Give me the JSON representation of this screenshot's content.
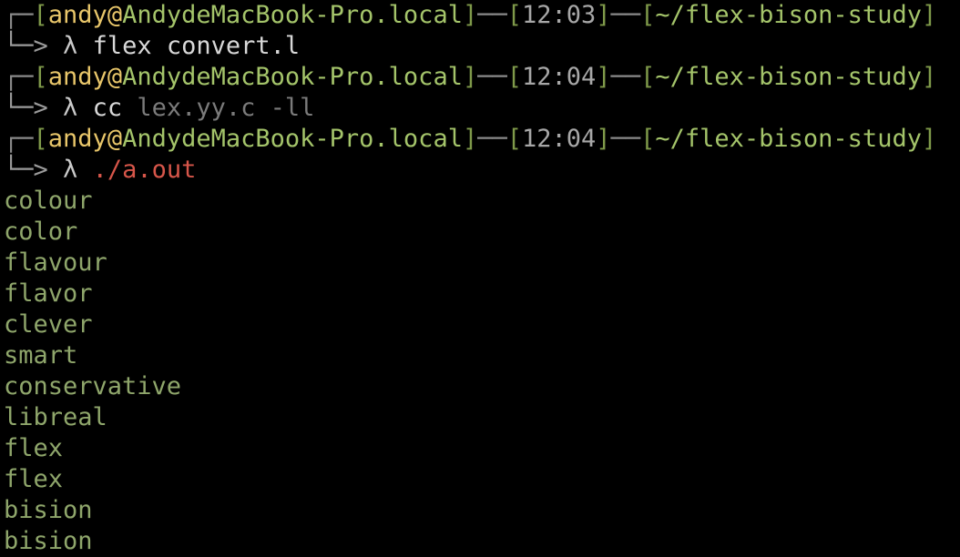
{
  "prompts": [
    {
      "prefix": "┌─",
      "user": "andy",
      "at": "@",
      "host": "AndydeMacBook-Pro.local",
      "sep": "─",
      "time": "12:03",
      "path": "~/flex-bison-study",
      "cmd_arrow": "└─>",
      "lambda": "λ",
      "command": "flex",
      "args": "convert.l"
    },
    {
      "prefix": "┌─",
      "user": "andy",
      "at": "@",
      "host": "AndydeMacBook-Pro.local",
      "sep": "─",
      "time": "12:04",
      "path": "~/flex-bison-study",
      "cmd_arrow": "└─>",
      "lambda": "λ",
      "command": "cc",
      "args": "lex.yy.c -ll"
    },
    {
      "prefix": "┌─",
      "user": "andy",
      "at": "@",
      "host": "AndydeMacBook-Pro.local",
      "sep": "─",
      "time": "12:04",
      "path": "~/flex-bison-study",
      "cmd_arrow": "└─>",
      "lambda": "λ",
      "command": "./a.out",
      "args": ""
    }
  ],
  "output_lines": [
    "colour",
    "color",
    "flavour",
    "flavor",
    "clever",
    "smart",
    "conservative",
    "libreal",
    "flex",
    "flex",
    "bision",
    "bision"
  ],
  "colors": {
    "background": "#000000",
    "user": "#e8c66a",
    "host": "#a4c46a",
    "path": "#a4c46a",
    "time": "#a7a7a7",
    "executable": "#d7564a",
    "output": "#8fa66b"
  }
}
